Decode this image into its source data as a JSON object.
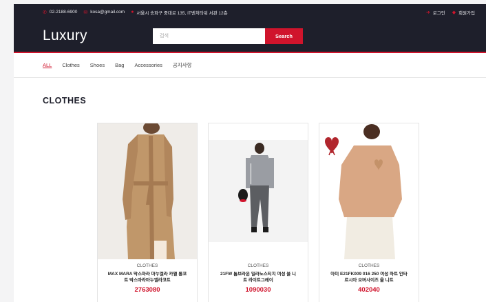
{
  "topbar": {
    "phone": "02-2188-6900",
    "email": "kosa@gmail.com",
    "address": "서울시 송파구 중대로 135, IT벤처타워 서관 12층",
    "login": "로그인",
    "signup": "회원가입"
  },
  "header": {
    "logo": "Luxury",
    "search_placeholder": "검색",
    "search_button": "Search"
  },
  "nav": {
    "items": [
      "ALL",
      "Clothes",
      "Shoes",
      "Bag",
      "Accessories",
      "공지사항"
    ],
    "active": "ALL"
  },
  "section": {
    "title": "CLOTHES"
  },
  "products": [
    {
      "category": "CLOTHES",
      "name": "MAX MARA 막스마라 마누엘라 카멜 롱코트 막스마라마누엘라코트",
      "price": "2763080"
    },
    {
      "category": "CLOTHES",
      "name": "21FW 톰브라운 밀라노스티치 여성 울 니트 라이트그레이",
      "price": "1090030"
    },
    {
      "category": "CLOTHES",
      "name": "아미 E21FK009 016 250 여성 하트 인타르시아 오버사이즈 울 니트",
      "price": "402040"
    }
  ],
  "colors": {
    "accent": "#d0142c",
    "dark": "#1e1f2b"
  }
}
